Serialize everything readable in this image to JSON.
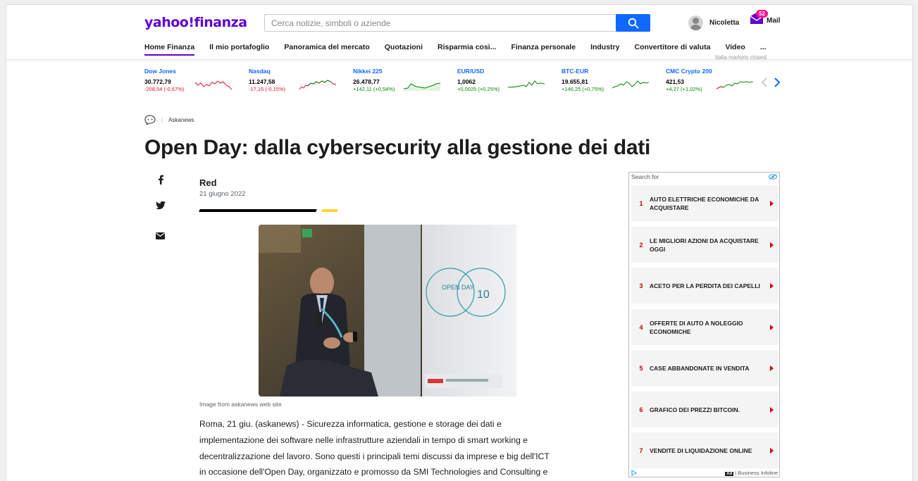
{
  "header": {
    "logo": "yahoo!finanza",
    "search_placeholder": "Cerca notizie, simboli o aziende",
    "user_name": "Nicoletta",
    "mail_count": "52",
    "mail_label": "Mail",
    "nav": [
      "Home Finanza",
      "Il mio portafoglio",
      "Panoramica del mercato",
      "Quotazioni",
      "Risparmia così...",
      "Finanza personale",
      "Industry",
      "Convertitore di valuta",
      "Video",
      "..."
    ],
    "active_nav": "Home Finanza",
    "markets_note": "Italia markets closed"
  },
  "ticker": [
    {
      "name": "Dow Jones",
      "value": "30.772,79",
      "change": "-208,54 (-0,67%)",
      "direction": "down"
    },
    {
      "name": "Nasdaq",
      "value": "11.247,58",
      "change": "-17,15 (-0,15%)",
      "direction": "down"
    },
    {
      "name": "Nikkei 225",
      "value": "26.478,77",
      "change": "+142,11 (+0,54%)",
      "direction": "up"
    },
    {
      "name": "EUR/USD",
      "value": "1,0062",
      "change": "+0,0025 (+0,25%)",
      "direction": "up"
    },
    {
      "name": "BTC-EUR",
      "value": "19.655,81",
      "change": "+146,25 (+0,75%)",
      "direction": "up"
    },
    {
      "name": "CMC Crypto 200",
      "value": "421,53",
      "change": "+4,27 (+1,02%)",
      "direction": "up"
    }
  ],
  "article": {
    "source": "Askanews",
    "title": "Open Day: dalla cybersecurity alla gestione dei dati",
    "author": "Red",
    "date": "21 giugno 2022",
    "image_caption": "Image from askanews web site",
    "photo_banner_day": "OPEN DAY",
    "photo_banner_num": "10",
    "body_lines": [
      "Roma, 21 giu. (askanews) - Sicurezza informatica, gestione e storage dei dati e",
      "implementazione dei software nelle infrastrutture aziendali in tempo di smart working e",
      "decentralizzazione del lavoro. Sono questi i principali temi discussi da imprese e big dell'ICT",
      "in occasione dell'Open Day, organizzato e promosso da SMI Technologies and Consulting e"
    ]
  },
  "ad": {
    "header": "Search for",
    "items": [
      {
        "num": "1",
        "text": "AUTO ELETTRICHE ECONOMICHE DA ACQUISTARE"
      },
      {
        "num": "2",
        "text": "LE MIGLIORI AZIONI DA ACQUISTARE OGGI"
      },
      {
        "num": "3",
        "text": "ACETO PER LA PERDITA DEI CAPELLI"
      },
      {
        "num": "4",
        "text": "OFFERTE DI AUTO A NOLEGGIO ECONOMICHE"
      },
      {
        "num": "5",
        "text": "CASE ABBANDONATE IN VENDITA"
      },
      {
        "num": "6",
        "text": "GRAFICO DEI PREZZI BITCOIN."
      },
      {
        "num": "7",
        "text": "VENDITE DI LIQUIDAZIONE ONLINE"
      }
    ],
    "ad_tag": "Ad",
    "footer": "| Business Infoline"
  },
  "colors": {
    "brand": "#5f01d1",
    "search_button": "#0f69ff",
    "ticker_link": "#0f69ff",
    "negative": "#eb0f29",
    "positive": "#008a00",
    "mail_badge": "#ff0b8c",
    "accent_yellow": "#ffd333"
  },
  "icons": [
    "search-icon",
    "avatar-icon",
    "mail-icon",
    "chevron-left-icon",
    "chevron-right-icon",
    "facebook-icon",
    "twitter-icon",
    "email-icon",
    "askanews-logo-icon",
    "adchoices-icon",
    "play-icon"
  ]
}
